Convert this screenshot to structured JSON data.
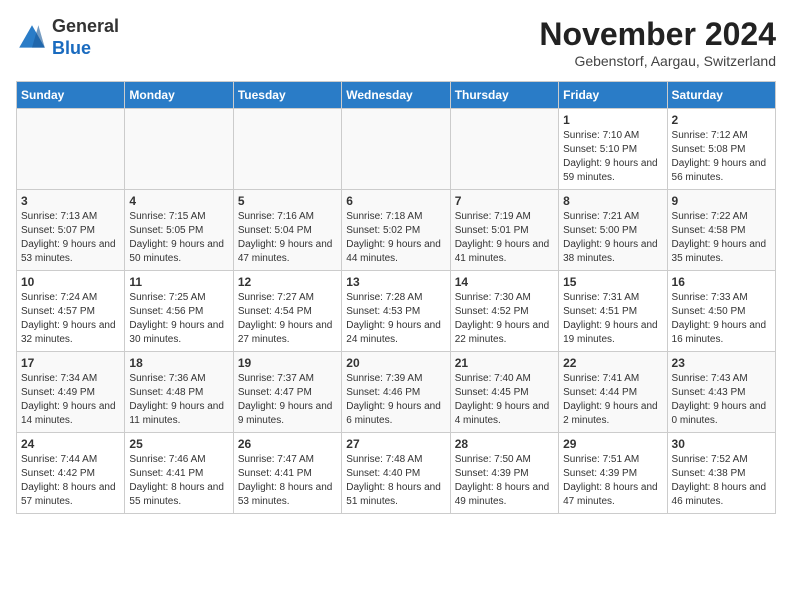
{
  "header": {
    "logo_general": "General",
    "logo_blue": "Blue",
    "month_title": "November 2024",
    "subtitle": "Gebenstorf, Aargau, Switzerland"
  },
  "weekdays": [
    "Sunday",
    "Monday",
    "Tuesday",
    "Wednesday",
    "Thursday",
    "Friday",
    "Saturday"
  ],
  "weeks": [
    [
      {
        "day": "",
        "info": ""
      },
      {
        "day": "",
        "info": ""
      },
      {
        "day": "",
        "info": ""
      },
      {
        "day": "",
        "info": ""
      },
      {
        "day": "",
        "info": ""
      },
      {
        "day": "1",
        "info": "Sunrise: 7:10 AM\nSunset: 5:10 PM\nDaylight: 9 hours and 59 minutes."
      },
      {
        "day": "2",
        "info": "Sunrise: 7:12 AM\nSunset: 5:08 PM\nDaylight: 9 hours and 56 minutes."
      }
    ],
    [
      {
        "day": "3",
        "info": "Sunrise: 7:13 AM\nSunset: 5:07 PM\nDaylight: 9 hours and 53 minutes."
      },
      {
        "day": "4",
        "info": "Sunrise: 7:15 AM\nSunset: 5:05 PM\nDaylight: 9 hours and 50 minutes."
      },
      {
        "day": "5",
        "info": "Sunrise: 7:16 AM\nSunset: 5:04 PM\nDaylight: 9 hours and 47 minutes."
      },
      {
        "day": "6",
        "info": "Sunrise: 7:18 AM\nSunset: 5:02 PM\nDaylight: 9 hours and 44 minutes."
      },
      {
        "day": "7",
        "info": "Sunrise: 7:19 AM\nSunset: 5:01 PM\nDaylight: 9 hours and 41 minutes."
      },
      {
        "day": "8",
        "info": "Sunrise: 7:21 AM\nSunset: 5:00 PM\nDaylight: 9 hours and 38 minutes."
      },
      {
        "day": "9",
        "info": "Sunrise: 7:22 AM\nSunset: 4:58 PM\nDaylight: 9 hours and 35 minutes."
      }
    ],
    [
      {
        "day": "10",
        "info": "Sunrise: 7:24 AM\nSunset: 4:57 PM\nDaylight: 9 hours and 32 minutes."
      },
      {
        "day": "11",
        "info": "Sunrise: 7:25 AM\nSunset: 4:56 PM\nDaylight: 9 hours and 30 minutes."
      },
      {
        "day": "12",
        "info": "Sunrise: 7:27 AM\nSunset: 4:54 PM\nDaylight: 9 hours and 27 minutes."
      },
      {
        "day": "13",
        "info": "Sunrise: 7:28 AM\nSunset: 4:53 PM\nDaylight: 9 hours and 24 minutes."
      },
      {
        "day": "14",
        "info": "Sunrise: 7:30 AM\nSunset: 4:52 PM\nDaylight: 9 hours and 22 minutes."
      },
      {
        "day": "15",
        "info": "Sunrise: 7:31 AM\nSunset: 4:51 PM\nDaylight: 9 hours and 19 minutes."
      },
      {
        "day": "16",
        "info": "Sunrise: 7:33 AM\nSunset: 4:50 PM\nDaylight: 9 hours and 16 minutes."
      }
    ],
    [
      {
        "day": "17",
        "info": "Sunrise: 7:34 AM\nSunset: 4:49 PM\nDaylight: 9 hours and 14 minutes."
      },
      {
        "day": "18",
        "info": "Sunrise: 7:36 AM\nSunset: 4:48 PM\nDaylight: 9 hours and 11 minutes."
      },
      {
        "day": "19",
        "info": "Sunrise: 7:37 AM\nSunset: 4:47 PM\nDaylight: 9 hours and 9 minutes."
      },
      {
        "day": "20",
        "info": "Sunrise: 7:39 AM\nSunset: 4:46 PM\nDaylight: 9 hours and 6 minutes."
      },
      {
        "day": "21",
        "info": "Sunrise: 7:40 AM\nSunset: 4:45 PM\nDaylight: 9 hours and 4 minutes."
      },
      {
        "day": "22",
        "info": "Sunrise: 7:41 AM\nSunset: 4:44 PM\nDaylight: 9 hours and 2 minutes."
      },
      {
        "day": "23",
        "info": "Sunrise: 7:43 AM\nSunset: 4:43 PM\nDaylight: 9 hours and 0 minutes."
      }
    ],
    [
      {
        "day": "24",
        "info": "Sunrise: 7:44 AM\nSunset: 4:42 PM\nDaylight: 8 hours and 57 minutes."
      },
      {
        "day": "25",
        "info": "Sunrise: 7:46 AM\nSunset: 4:41 PM\nDaylight: 8 hours and 55 minutes."
      },
      {
        "day": "26",
        "info": "Sunrise: 7:47 AM\nSunset: 4:41 PM\nDaylight: 8 hours and 53 minutes."
      },
      {
        "day": "27",
        "info": "Sunrise: 7:48 AM\nSunset: 4:40 PM\nDaylight: 8 hours and 51 minutes."
      },
      {
        "day": "28",
        "info": "Sunrise: 7:50 AM\nSunset: 4:39 PM\nDaylight: 8 hours and 49 minutes."
      },
      {
        "day": "29",
        "info": "Sunrise: 7:51 AM\nSunset: 4:39 PM\nDaylight: 8 hours and 47 minutes."
      },
      {
        "day": "30",
        "info": "Sunrise: 7:52 AM\nSunset: 4:38 PM\nDaylight: 8 hours and 46 minutes."
      }
    ]
  ]
}
